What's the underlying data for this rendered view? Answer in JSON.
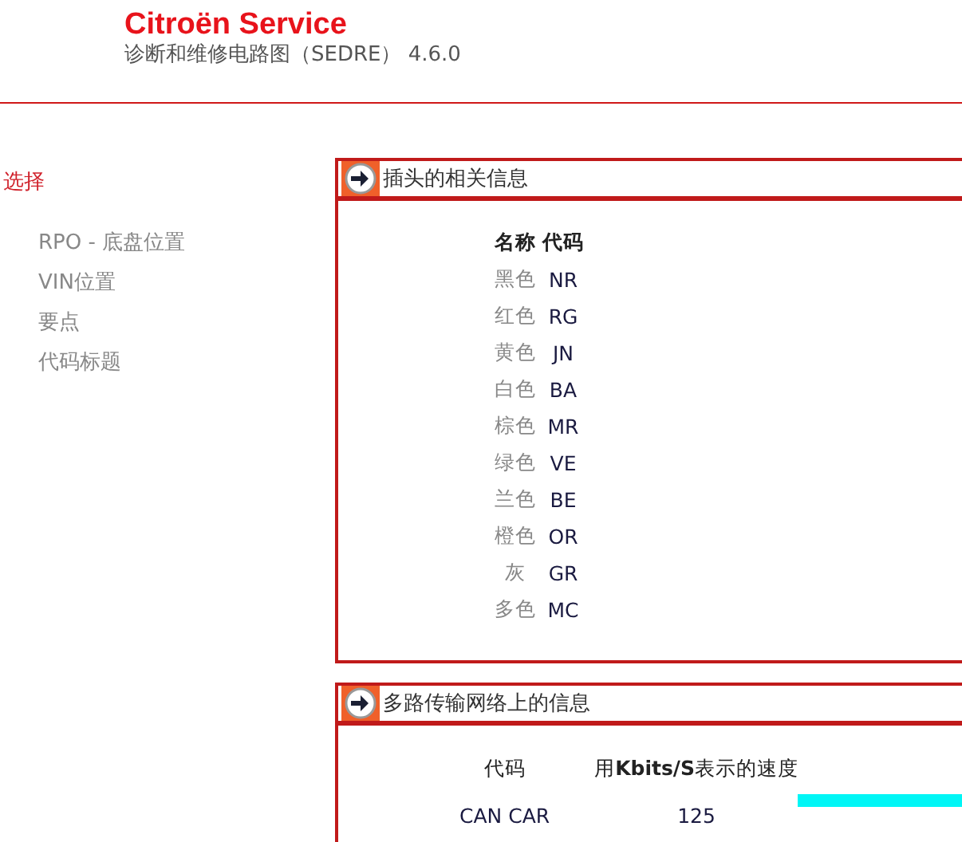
{
  "header": {
    "title": "Citroën Service",
    "subtitle": "诊断和维修电路图（SEDRE） 4.6.0"
  },
  "sidebar": {
    "heading": "选择",
    "items": [
      {
        "label": "RPO - 底盘位置"
      },
      {
        "label": "VIN位置"
      },
      {
        "label": "要点"
      },
      {
        "label": "代码标题"
      }
    ]
  },
  "connector_panel": {
    "title": "插头的相关信息",
    "columns": [
      "名称",
      "代码"
    ],
    "rows": [
      {
        "name": "黑色",
        "code": "NR"
      },
      {
        "name": "红色",
        "code": "RG"
      },
      {
        "name": "黄色",
        "code": "JN"
      },
      {
        "name": "白色",
        "code": "BA"
      },
      {
        "name": "棕色",
        "code": "MR"
      },
      {
        "name": "绿色",
        "code": "VE"
      },
      {
        "name": "兰色",
        "code": "BE"
      },
      {
        "name": "橙色",
        "code": "OR"
      },
      {
        "name": "灰",
        "code": "GR"
      },
      {
        "name": "多色",
        "code": "MC"
      }
    ]
  },
  "network_panel": {
    "title": "多路传输网络上的信息",
    "columns": [
      "代码",
      "用**Kbits/S**表示的速度"
    ],
    "rows": [
      {
        "code": "CAN CAR",
        "speed": "125"
      }
    ]
  }
}
